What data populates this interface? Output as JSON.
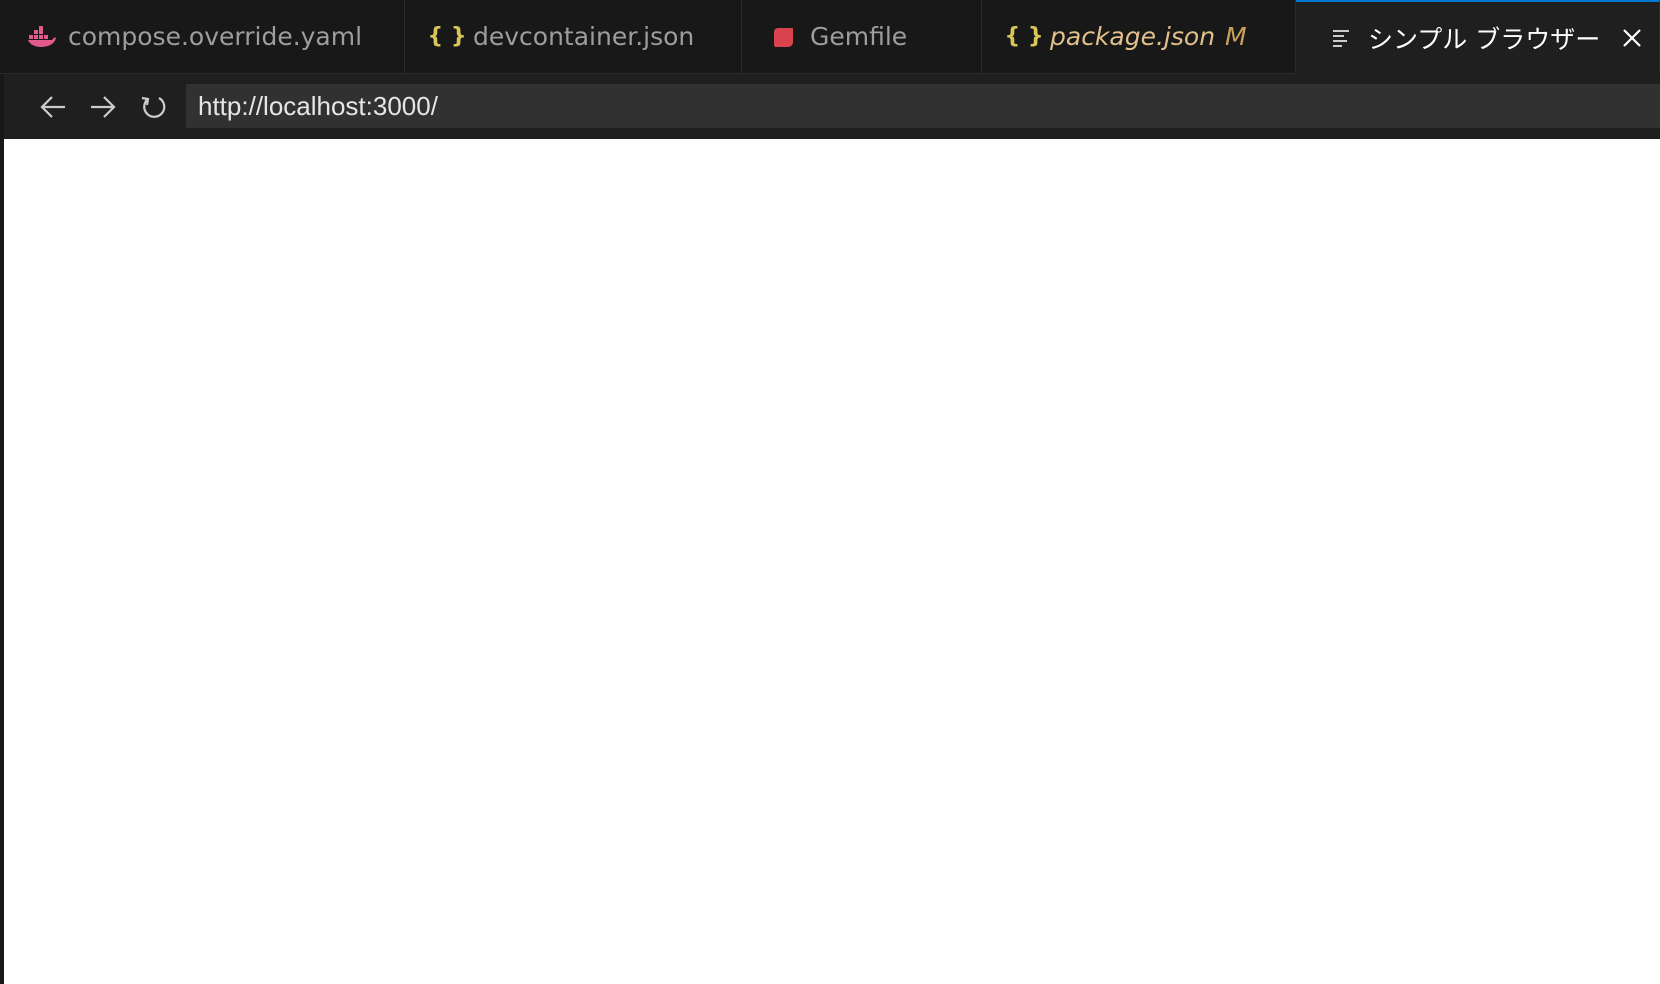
{
  "tabs": [
    {
      "label": "compose.override.yaml",
      "icon": "docker-icon",
      "icon_color": "#e25a8c",
      "active": false
    },
    {
      "label": "devcontainer.json",
      "icon": "json-braces-icon",
      "icon_glyph": "{ }",
      "icon_color": "#d7c65a",
      "active": false
    },
    {
      "label": "Gemfile",
      "icon": "ruby-gem-icon",
      "icon_color": "#d9434d",
      "active": false
    },
    {
      "label": "package.json",
      "icon": "json-braces-icon",
      "icon_glyph": "{ }",
      "icon_color": "#d7c65a",
      "modified": "M",
      "active": false
    },
    {
      "label": "シンプル ブラウザー",
      "icon": "preview-lines-icon",
      "active": true
    }
  ],
  "browser": {
    "url": "http://localhost:3000/"
  },
  "colors": {
    "active_tab_border": "#0078d4",
    "background": "#181818",
    "page": "#ffffff"
  }
}
